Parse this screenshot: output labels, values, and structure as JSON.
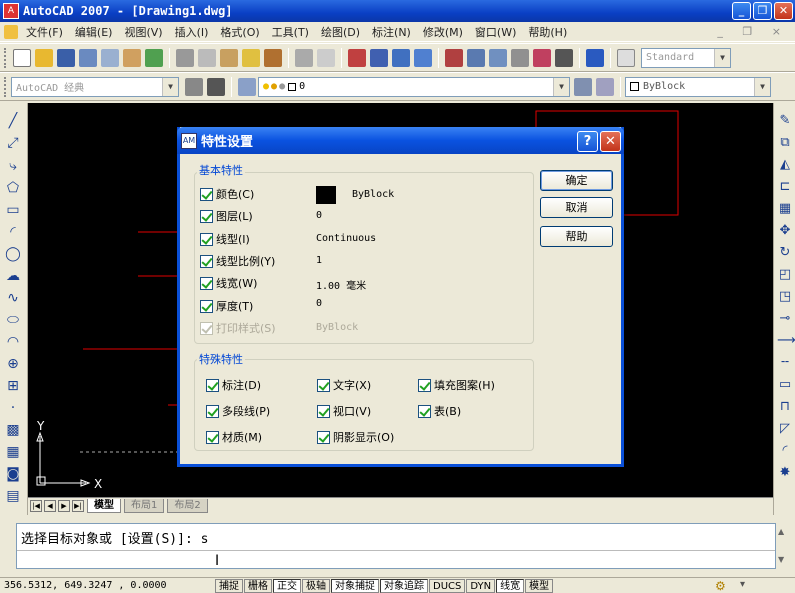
{
  "window": {
    "title": "AutoCAD 2007 - [Drawing1.dwg]",
    "app_icon": "autocad-logo-icon",
    "min_glyph": "_",
    "restore_glyph": "❐",
    "close_glyph": "✕"
  },
  "menu": [
    "文件(F)",
    "编辑(E)",
    "视图(V)",
    "插入(I)",
    "格式(O)",
    "工具(T)",
    "绘图(D)",
    "标注(N)",
    "修改(M)",
    "窗口(W)",
    "帮助(H)"
  ],
  "doc_controls": "_ ❐ ×",
  "toolbar2": {
    "text_style": "Standard",
    "workspace": "AutoCAD 经典",
    "layer": "0",
    "color": "ByBlock"
  },
  "tabs": [
    "模型",
    "布局1",
    "布局2"
  ],
  "command": {
    "line1": "选择目标对象或 [设置(S)]: s",
    "line2": ""
  },
  "status": {
    "coords": "356.5312,  649.3247 , 0.0000",
    "buttons": [
      "捕捉",
      "栅格",
      "正交",
      "极轴",
      "对象捕捉",
      "对象追踪",
      "DUCS",
      "DYN",
      "线宽",
      "模型"
    ]
  },
  "ucs": {
    "x": "X",
    "y": "Y"
  },
  "dialog": {
    "title": "特性设置",
    "help_glyph": "?",
    "close_glyph": "✕",
    "basic_group": "基本特性",
    "special_group": "特殊特性",
    "basic": [
      {
        "label": "颜色(C)",
        "value": "ByBlock",
        "checked": true
      },
      {
        "label": "图层(L)",
        "value": "0",
        "checked": true
      },
      {
        "label": "线型(I)",
        "value": "Continuous",
        "checked": true
      },
      {
        "label": "线型比例(Y)",
        "value": "1",
        "checked": true
      },
      {
        "label": "线宽(W)",
        "value": "1.00 毫米",
        "checked": true
      },
      {
        "label": "厚度(T)",
        "value": "0",
        "checked": true
      },
      {
        "label": "打印样式(S)",
        "value": "ByBlock",
        "checked": true,
        "disabled": true
      }
    ],
    "special": [
      {
        "label": "标注(D)",
        "checked": true
      },
      {
        "label": "文字(X)",
        "checked": true
      },
      {
        "label": "填充图案(H)",
        "checked": true
      },
      {
        "label": "多段线(P)",
        "checked": true
      },
      {
        "label": "视口(V)",
        "checked": true
      },
      {
        "label": "表(B)",
        "checked": true
      },
      {
        "label": "材质(M)",
        "checked": true
      },
      {
        "label": "阴影显示(O)",
        "checked": true
      }
    ],
    "buttons": {
      "ok": "确定",
      "cancel": "取消",
      "help": "帮助"
    },
    "swatch_color": "#000000"
  }
}
